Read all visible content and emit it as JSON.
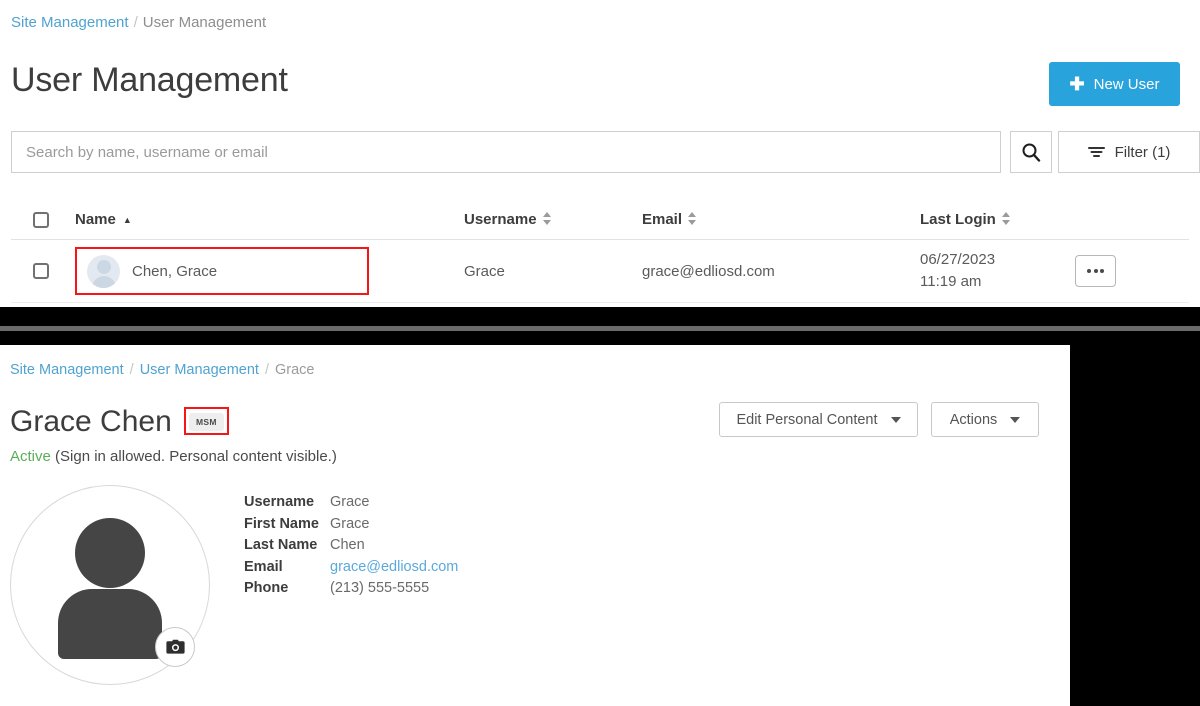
{
  "list_panel": {
    "breadcrumb": {
      "root": "Site Management",
      "separator": "/",
      "current": "User Management"
    },
    "page_title": "User Management",
    "new_user_button": {
      "label": "New User",
      "icon": "plus-icon",
      "color": "#29a3dc"
    },
    "search": {
      "placeholder": "Search by name, username or email",
      "value": "",
      "search_icon": "search-icon"
    },
    "filter_button": {
      "label": "Filter (1)",
      "icon": "filter-icon"
    },
    "table": {
      "columns": [
        {
          "key": "select",
          "label": "",
          "sort": "none"
        },
        {
          "key": "name",
          "label": "Name",
          "sort": "asc",
          "sort_icon": "sort-ascending-icon"
        },
        {
          "key": "username",
          "label": "Username",
          "sort": "both",
          "sort_icon": "sort-both-icon"
        },
        {
          "key": "email",
          "label": "Email",
          "sort": "both",
          "sort_icon": "sort-both-icon"
        },
        {
          "key": "last_login",
          "label": "Last Login",
          "sort": "both",
          "sort_icon": "sort-both-icon"
        },
        {
          "key": "actions",
          "label": "",
          "sort": "none"
        }
      ],
      "rows": [
        {
          "selected": false,
          "avatar": "default-user-avatar",
          "name": "Chen, Grace",
          "name_highlighted": true,
          "username": "Grace",
          "email": "grace@edliosd.com",
          "last_login_date": "06/27/2023",
          "last_login_time": "11:19 am",
          "row_menu": "ellipsis-icon"
        }
      ]
    },
    "highlight_color": "#f31717"
  },
  "detail_panel": {
    "breadcrumb": {
      "root": "Site Management",
      "parent": "User Management",
      "separator": "/",
      "current": "Grace"
    },
    "user_name": "Grace Chen",
    "badge": {
      "label": "MSM",
      "highlighted": true
    },
    "status": {
      "state": "Active",
      "state_color": "#5aae5a",
      "description": "(Sign in allowed. Personal content visible.)"
    },
    "buttons": {
      "edit_personal_content": "Edit Personal Content",
      "actions": "Actions"
    },
    "avatar": {
      "placeholder": "default-user-silhouette",
      "camera_button": "camera-icon"
    },
    "fields": [
      {
        "label": "Username",
        "value": "Grace",
        "is_link": false
      },
      {
        "label": "First Name",
        "value": "Grace",
        "is_link": false
      },
      {
        "label": "Last Name",
        "value": "Chen",
        "is_link": false
      },
      {
        "label": "Email",
        "value": "grace@edliosd.com",
        "is_link": true
      },
      {
        "label": "Phone",
        "value": "(213) 555-5555",
        "is_link": false
      }
    ]
  }
}
